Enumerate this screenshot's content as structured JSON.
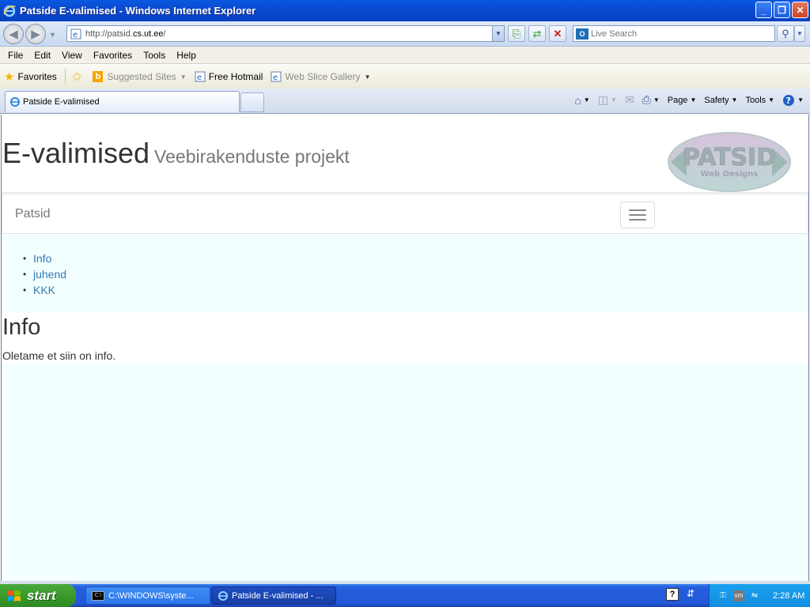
{
  "window": {
    "title": "Patside E-valimised - Windows Internet Explorer",
    "buttons": [
      "_",
      "❐",
      "✕"
    ]
  },
  "address_bar": {
    "url_prefix": "http://patsid.",
    "url_host": "cs.ut.ee",
    "url_suffix": "/",
    "search_placeholder": "Live Search"
  },
  "menu": [
    "File",
    "Edit",
    "View",
    "Favorites",
    "Tools",
    "Help"
  ],
  "favorites_bar": {
    "favorites_label": "Favorites",
    "suggested_sites": "Suggested Sites",
    "free_hotmail": "Free Hotmail",
    "web_slice_gallery": "Web Slice Gallery"
  },
  "tabs": [
    {
      "label": "Patside E-valimised"
    }
  ],
  "command_bar": {
    "page": "Page",
    "safety": "Safety",
    "tools": "Tools"
  },
  "page": {
    "title": "E-valimised",
    "subtitle": "Veebirakenduste projekt",
    "logo_text": "PATSID",
    "logo_subtext": "Web Designs",
    "brand": "Patsid",
    "nav_links": [
      "Info",
      "juhend",
      "KKK"
    ],
    "heading": "Info",
    "body_text": "Oletame et siin on info.",
    "background_color": "#f3ffff",
    "link_color": "#337ab7"
  },
  "taskbar": {
    "start_label": "start",
    "items": [
      {
        "label": "C:\\WINDOWS\\syste..."
      },
      {
        "label": "Patside E-valimised - ..."
      }
    ],
    "clock": "2:28 AM"
  }
}
